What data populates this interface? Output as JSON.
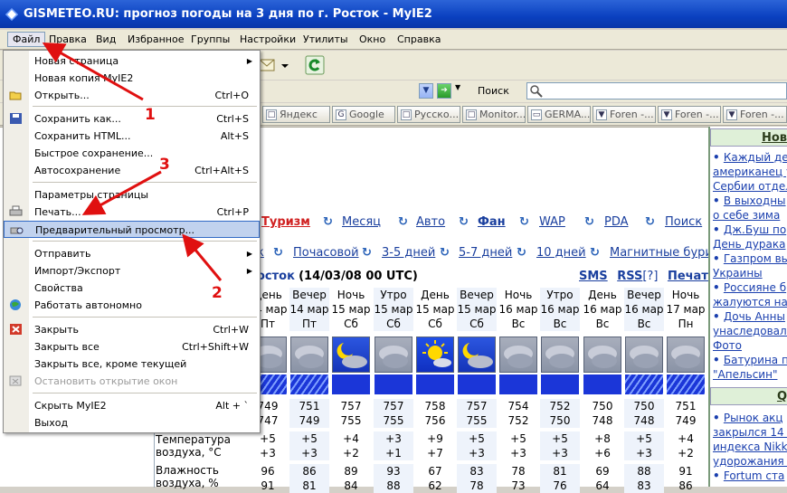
{
  "window": {
    "title": "GISMETEO.RU: прогноз погоды на 3 дня по г. Росток - MyIE2"
  },
  "menubar": [
    "Файл",
    "Правка",
    "Вид",
    "Избранное",
    "Группы",
    "Настройки",
    "Утилиты",
    "Окно",
    "Справка"
  ],
  "addressbar": {
    "search_label": "Поиск"
  },
  "tabs": [
    "Яндекс",
    "Google",
    "Русско...",
    "Monitor...",
    "GERMA...",
    "Foren -...",
    "Foren -...",
    "Foren -..."
  ],
  "page": {
    "nav1": [
      "Туризм",
      "Месяц",
      "Авто",
      "Фан",
      "WAP",
      "PDA",
      "Поиск"
    ],
    "nav2": [
      "Почасовой",
      "3-5 дней",
      "5-7 дней",
      "10 дней",
      "Магнитные бури"
    ],
    "city_title": "осток",
    "city_date": "(14/03/08 00 UTC)",
    "links": {
      "sms": "SMS",
      "rss": "RSS",
      "rss_help": "[?]",
      "print": "Печать"
    },
    "forecast_columns": [
      {
        "tod": "День",
        "date": "14 мар",
        "dow": "Пт",
        "sky": "cloudy",
        "rain": "dots",
        "pressure": [
          "749",
          "747"
        ],
        "temp": [
          "+5",
          "+3"
        ],
        "humidity": [
          "96",
          "91"
        ]
      },
      {
        "tod": "Вечер",
        "date": "14 мар",
        "dow": "Пт",
        "sky": "cloudy",
        "rain": "dots",
        "pressure": [
          "751",
          "749"
        ],
        "temp": [
          "+5",
          "+3"
        ],
        "humidity": [
          "86",
          "81"
        ]
      },
      {
        "tod": "Ночь",
        "date": "15 мар",
        "dow": "Сб",
        "sky": "moon",
        "rain": "solid",
        "pressure": [
          "757",
          "755"
        ],
        "temp": [
          "+4",
          "+2"
        ],
        "humidity": [
          "89",
          "84"
        ]
      },
      {
        "tod": "Утро",
        "date": "15 мар",
        "dow": "Сб",
        "sky": "cloudy",
        "rain": "solid",
        "pressure": [
          "757",
          "755"
        ],
        "temp": [
          "+3",
          "+1"
        ],
        "humidity": [
          "93",
          "88"
        ]
      },
      {
        "tod": "День",
        "date": "15 мар",
        "dow": "Сб",
        "sky": "sunny",
        "rain": "solid",
        "pressure": [
          "758",
          "756"
        ],
        "temp": [
          "+9",
          "+7"
        ],
        "humidity": [
          "67",
          "62"
        ]
      },
      {
        "tod": "Вечер",
        "date": "15 мар",
        "dow": "Сб",
        "sky": "moon",
        "rain": "solid",
        "pressure": [
          "757",
          "755"
        ],
        "temp": [
          "+5",
          "+3"
        ],
        "humidity": [
          "83",
          "78"
        ]
      },
      {
        "tod": "Ночь",
        "date": "16 мар",
        "dow": "Вс",
        "sky": "cloudy",
        "rain": "solid",
        "pressure": [
          "754",
          "752"
        ],
        "temp": [
          "+5",
          "+3"
        ],
        "humidity": [
          "78",
          "73"
        ]
      },
      {
        "tod": "Утро",
        "date": "16 мар",
        "dow": "Вс",
        "sky": "cloudy",
        "rain": "solid",
        "pressure": [
          "752",
          "750"
        ],
        "temp": [
          "+5",
          "+3"
        ],
        "humidity": [
          "81",
          "76"
        ]
      },
      {
        "tod": "День",
        "date": "16 мар",
        "dow": "Вс",
        "sky": "cloudy",
        "rain": "solid",
        "pressure": [
          "750",
          "748"
        ],
        "temp": [
          "+8",
          "+6"
        ],
        "humidity": [
          "69",
          "64"
        ]
      },
      {
        "tod": "Вечер",
        "date": "16 мар",
        "dow": "Вс",
        "sky": "cloudy",
        "rain": "dots",
        "pressure": [
          "750",
          "748"
        ],
        "temp": [
          "+5",
          "+3"
        ],
        "humidity": [
          "88",
          "83"
        ]
      },
      {
        "tod": "Ночь",
        "date": "17 мар",
        "dow": "Пн",
        "sky": "cloudy",
        "rain": "dots",
        "pressure": [
          "751",
          "749"
        ],
        "temp": [
          "+4",
          "+2"
        ],
        "humidity": [
          "91",
          "86"
        ]
      }
    ],
    "row_labels": {
      "temp1": "Температура",
      "temp2": "воздуха, °C",
      "hum1": "Влажность",
      "hum2": "воздуха, %"
    }
  },
  "sidebar": {
    "head1": "Нов",
    "head2": "Q",
    "news1": [
      "Каждый де",
      "американец у",
      "Сербии отдел",
      "В выходны",
      "о себе зима",
      "Дж.Буш по",
      "День дурака",
      "Газпром вы",
      "Украины",
      "Россияне б",
      "жалуются на",
      "Дочь Анны",
      "унаследовала",
      "Фото",
      "Батурина п",
      "\"Апельсин\""
    ],
    "news2": [
      "Рынок акц",
      "закрылся 14 м",
      "индекса Nikke",
      "удорожания и",
      "Fortum ста"
    ]
  },
  "file_menu": {
    "items": [
      {
        "label": "Новая страница",
        "shortcut": "",
        "submenu": true
      },
      {
        "label": "Новая копия MyIE2",
        "shortcut": ""
      },
      {
        "label": "Открыть...",
        "shortcut": "Ctrl+O",
        "icon": "open-folder-icon"
      },
      {
        "label": "Сохранить как...",
        "shortcut": "Ctrl+S",
        "icon": "save-disk-icon"
      },
      {
        "label": "Сохранить HTML...",
        "shortcut": "Alt+S"
      },
      {
        "label": "Быстрое сохранение...",
        "shortcut": ""
      },
      {
        "label": "Автосохранение",
        "shortcut": "Ctrl+Alt+S"
      },
      {
        "label": "Параметры страницы",
        "shortcut": ""
      },
      {
        "label": "Печать...",
        "shortcut": "Ctrl+P",
        "icon": "printer-icon"
      },
      {
        "label": "Предварительный просмотр...",
        "shortcut": "",
        "icon": "print-preview-icon",
        "highlighted": true
      },
      {
        "label": "Отправить",
        "shortcut": "",
        "submenu": true
      },
      {
        "label": "Импорт/Экспорт",
        "shortcut": "",
        "submenu": true
      },
      {
        "label": "Свойства",
        "shortcut": ""
      },
      {
        "label": "Работать автономно",
        "shortcut": "",
        "icon": "offline-globe-icon"
      },
      {
        "label": "Закрыть",
        "shortcut": "Ctrl+W",
        "icon": "close-red-icon"
      },
      {
        "label": "Закрыть все",
        "shortcut": "Ctrl+Shift+W"
      },
      {
        "label": "Закрыть все, кроме текущей",
        "shortcut": ""
      },
      {
        "label": "Остановить открытие окон",
        "shortcut": "",
        "disabled": true,
        "icon": "stop-popup-icon"
      },
      {
        "label": "Скрыть MyIE2",
        "shortcut": "Alt + `"
      },
      {
        "label": "Выход",
        "shortcut": ""
      }
    ]
  },
  "annotations": {
    "callout1": "1",
    "callout2": "2",
    "callout3": "3"
  },
  "colors": {
    "arrow": "#e01010",
    "highlight": "#c1d2ee",
    "title_blue": "#0a40c0"
  }
}
